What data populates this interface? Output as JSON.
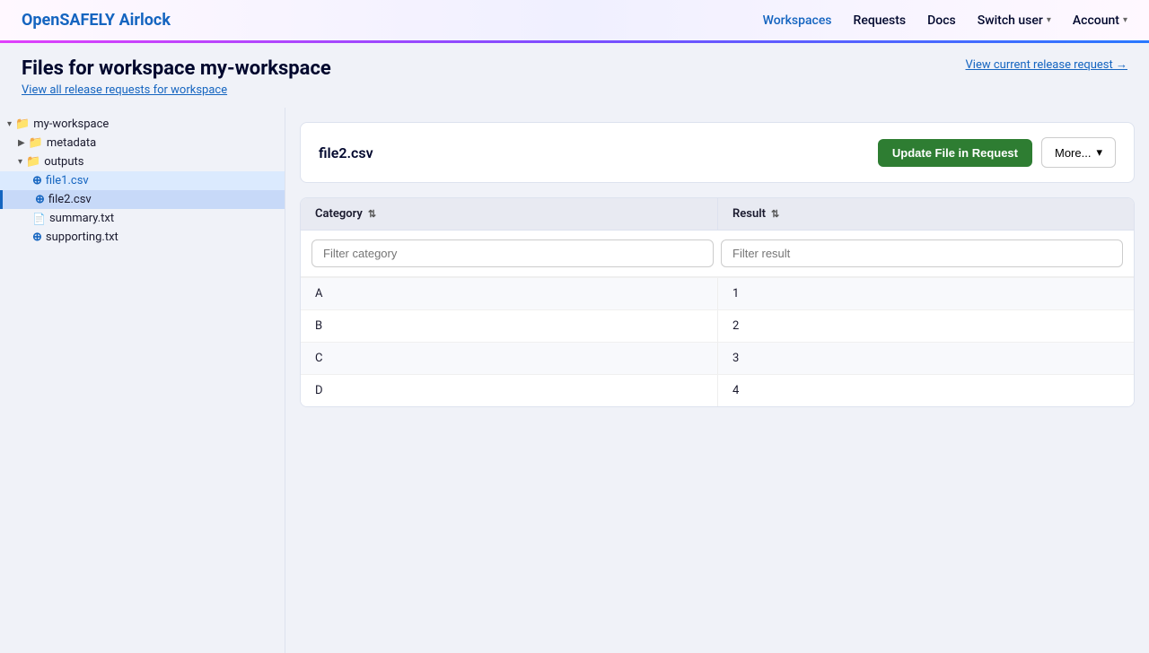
{
  "header": {
    "logo_open": "OpenSAFELY",
    "logo_airlock": "Airlock",
    "nav": {
      "workspaces": "Workspaces",
      "requests": "Requests",
      "docs": "Docs",
      "switch_user": "Switch user",
      "account": "Account"
    }
  },
  "page": {
    "title": "Files for workspace my-workspace",
    "view_all_link": "View all release requests for workspace",
    "view_current_link": "View current release request →"
  },
  "sidebar": {
    "root": "my-workspace",
    "items": [
      {
        "label": "metadata",
        "type": "folder",
        "indent": 1,
        "expanded": false
      },
      {
        "label": "outputs",
        "type": "folder",
        "indent": 1,
        "expanded": true
      },
      {
        "label": "file1.csv",
        "type": "file-in-request",
        "indent": 2
      },
      {
        "label": "file2.csv",
        "type": "file-in-request",
        "indent": 2,
        "active": true
      },
      {
        "label": "summary.txt",
        "type": "file",
        "indent": 2
      },
      {
        "label": "supporting.txt",
        "type": "file-add",
        "indent": 2
      }
    ]
  },
  "file_panel": {
    "filename": "file2.csv",
    "update_btn": "Update File in Request",
    "more_btn": "More..."
  },
  "table": {
    "columns": [
      {
        "label": "Category"
      },
      {
        "label": "Result"
      }
    ],
    "filter_category_placeholder": "Filter category",
    "filter_result_placeholder": "Filter result",
    "rows": [
      {
        "category": "A",
        "result": "1"
      },
      {
        "category": "B",
        "result": "2"
      },
      {
        "category": "C",
        "result": "3"
      },
      {
        "category": "D",
        "result": "4"
      }
    ]
  }
}
